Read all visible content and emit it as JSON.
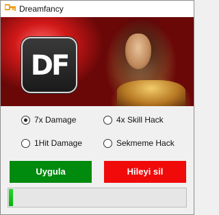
{
  "window": {
    "title": "Dreamfancy",
    "icon": "key-icon",
    "accent_color": "#f0a020"
  },
  "banner": {
    "logo_text": "DF"
  },
  "options": [
    {
      "label": "7x Damage",
      "checked": true
    },
    {
      "label": "4x Skill Hack",
      "checked": false
    },
    {
      "label": "1Hit Damage",
      "checked": false
    },
    {
      "label": "Sekmeme Hack",
      "checked": false
    }
  ],
  "buttons": {
    "apply_label": "Uygula",
    "apply_color": "#008a0e",
    "remove_label": "Hileyi sil",
    "remove_color": "#f00a0a"
  },
  "progress": {
    "value_percent": 2,
    "fill_color": "#06b00e"
  }
}
